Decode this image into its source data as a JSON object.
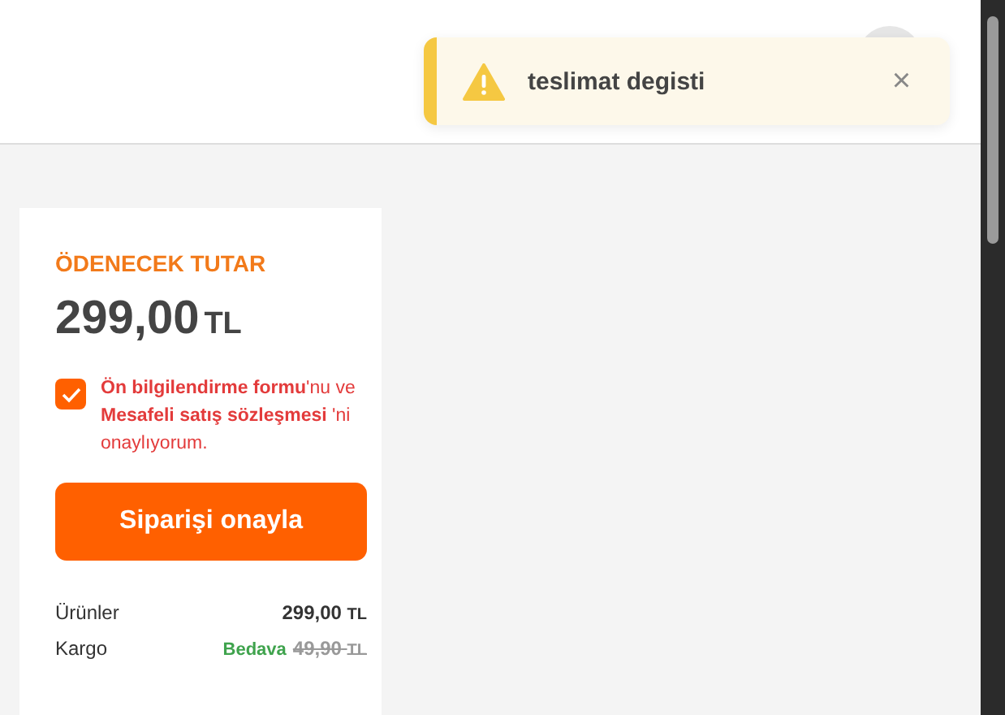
{
  "toast": {
    "kind": "warning",
    "message": "teslimat degisti",
    "close": "×"
  },
  "summary": {
    "title": "ÖDENECEK TUTAR",
    "amount": "299,00",
    "currency": "TL",
    "terms": {
      "checked": true,
      "text": "**Ön bilgilendirme formu**'nu ve **Mesafeli satış sözleşmesi** 'ni onaylıyorum."
    },
    "confirm_button": "Siparişi onayla",
    "lines": [
      {
        "label": "Ürünler",
        "amount": "299,00",
        "currency": "TL"
      },
      {
        "label": "Kargo",
        "badge": "Bedava",
        "amount": "49,90",
        "currency": "TL",
        "struck": true
      }
    ]
  }
}
